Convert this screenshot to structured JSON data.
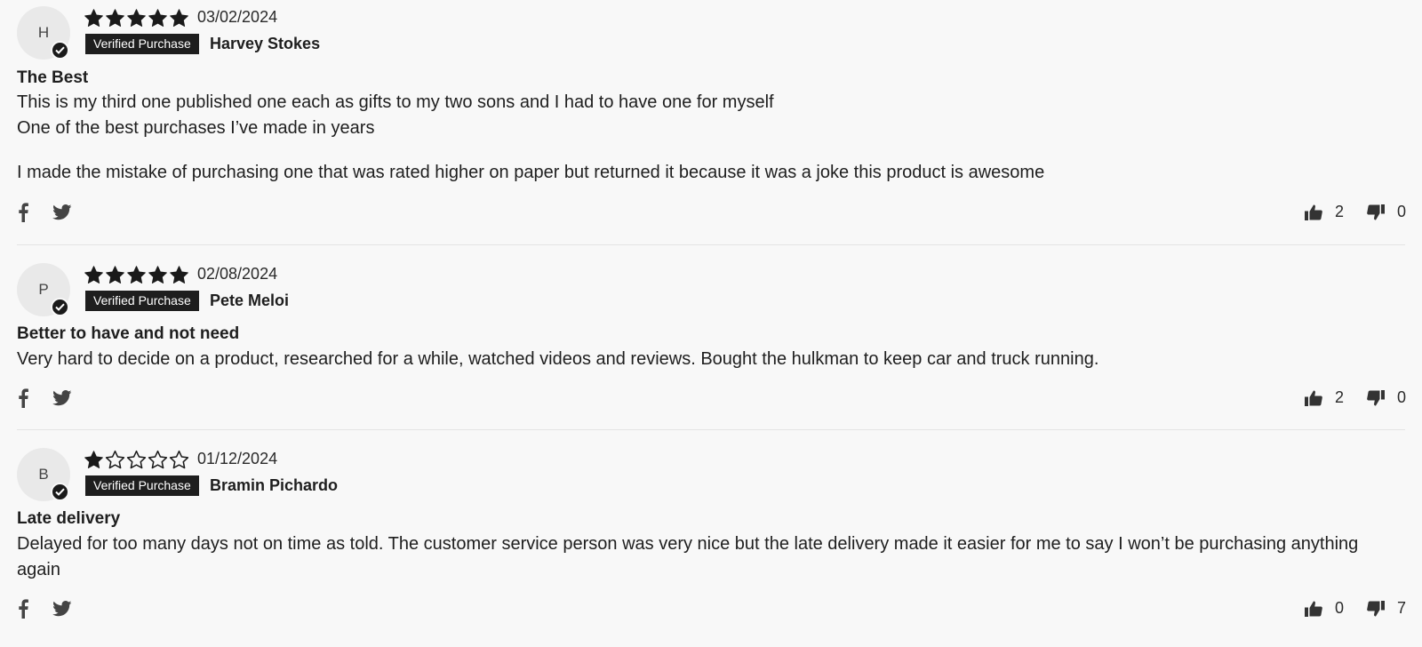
{
  "reviews": [
    {
      "initial": "H",
      "rating": 5,
      "date": "03/02/2024",
      "badge": "Verified Purchase",
      "author": "Harvey Stokes",
      "title": "The Best",
      "body": [
        "This is my third one published one each as gifts to my two sons and I had to have one for myself",
        "One of the best purchases I’ve made in years",
        "I made the mistake of purchasing one that was rated higher on paper but returned it because it was a joke this product is awesome"
      ],
      "helpful": "2",
      "unhelpful": "0"
    },
    {
      "initial": "P",
      "rating": 5,
      "date": "02/08/2024",
      "badge": "Verified Purchase",
      "author": "Pete Meloi",
      "title": "Better to have and not need",
      "body": [
        "Very hard to decide on a product, researched for a while, watched videos and reviews. Bought the hulkman to keep car and truck running."
      ],
      "helpful": "2",
      "unhelpful": "0"
    },
    {
      "initial": "B",
      "rating": 1,
      "date": "01/12/2024",
      "badge": "Verified Purchase",
      "author": "Bramin Pichardo",
      "title": "Late delivery",
      "body": [
        "Delayed for too many days not on time as told. The customer service person was very nice but the late delivery made it easier for me to say I won’t be purchasing anything again"
      ],
      "helpful": "0",
      "unhelpful": "7"
    }
  ],
  "icons": {
    "star_filled": "star-filled-icon",
    "star_empty": "star-outline-icon",
    "verified": "check-circle-icon",
    "facebook": "facebook-icon",
    "twitter": "twitter-icon",
    "thumbs_up": "thumbs-up-icon",
    "thumbs_down": "thumbs-down-icon"
  },
  "colors": {
    "background": "#f8f8f8",
    "text": "#1e1e1e",
    "badge": "#1e1e1e",
    "avatar": "#e9e9e9",
    "divider": "#e4e4e4"
  }
}
